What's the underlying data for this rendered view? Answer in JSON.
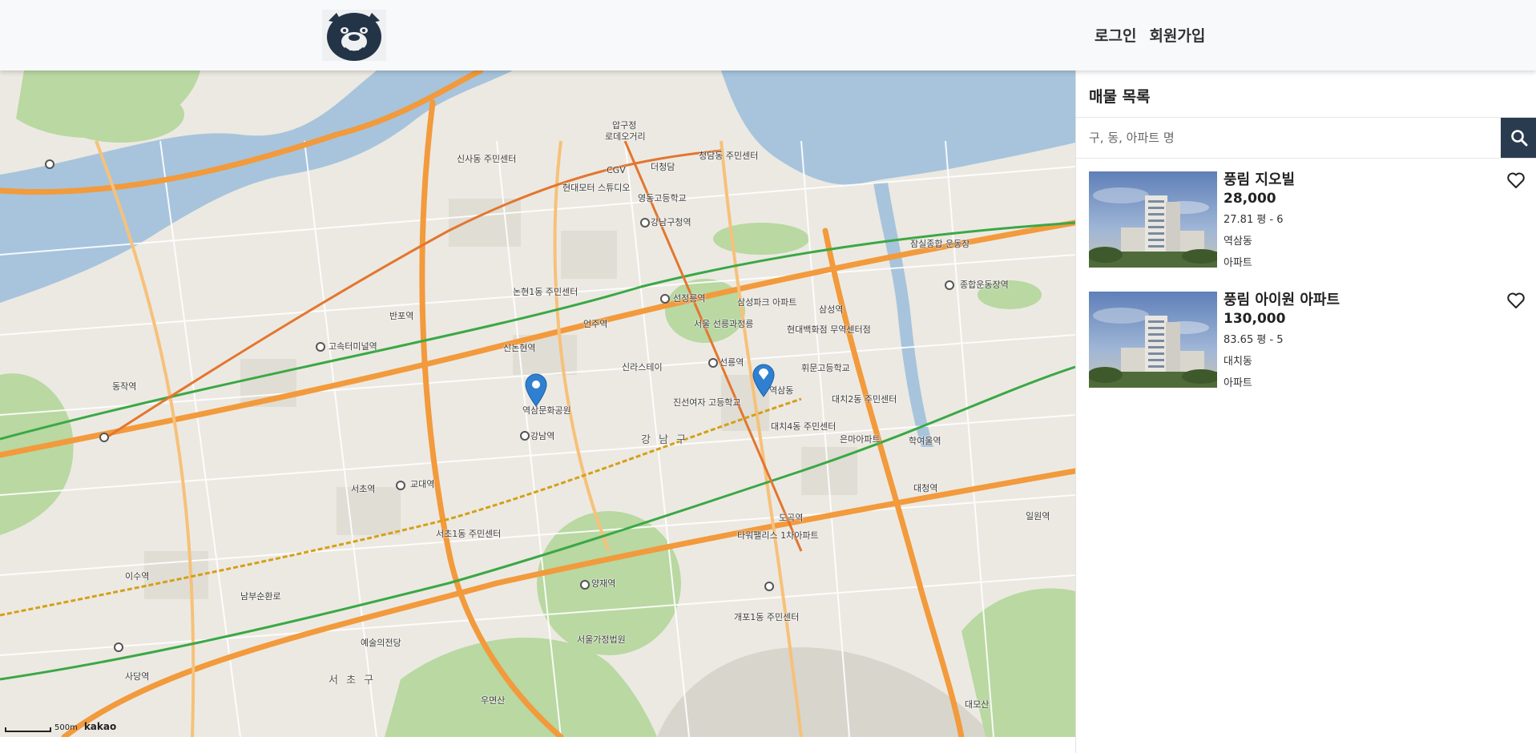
{
  "header": {
    "login_label": "로그인",
    "signup_label": "회원가입"
  },
  "sidebar": {
    "title": "매물 목록",
    "search_placeholder": "구, 동, 아파트 명",
    "listings": [
      {
        "name": "풍림 지오빌",
        "price": "28,000",
        "detail": "27.81 평 - 6",
        "dong": "역삼동",
        "type": "아파트"
      },
      {
        "name": "풍림 아이원 아파트",
        "price": "130,000",
        "detail": "83.65 평 - 5",
        "dong": "대치동",
        "type": "아파트"
      }
    ]
  },
  "map": {
    "scale_label": "500m",
    "provider_label": "kakao",
    "district_labels": [
      "강 남 구",
      "서 초 구"
    ],
    "place_labels": [
      "압구정",
      "로데오거리",
      "신사동 주민센터",
      "현대모터 스튜디오",
      "CGV",
      "더청담",
      "청담동 주민센터",
      "영동고등학교",
      "강남구청역",
      "논현1동 주민센터",
      "신논현역",
      "언주역",
      "선정릉역",
      "삼성파크 아파트",
      "서울 선릉과정릉",
      "현대백화점 무역센터점",
      "선릉역",
      "삼성역",
      "종합운동장역",
      "역삼문화공원",
      "강남역",
      "역삼동",
      "신라스테이",
      "진선여자 고등학교",
      "대치4동 주민센터",
      "교대역",
      "서초1동 주민센터",
      "양재역",
      "도곡역",
      "타워팰리스 1차아파트",
      "개포1동 주민센터",
      "대모산",
      "잠실종합 운동장",
      "동작역",
      "고속터미널역",
      "반포역",
      "서초역",
      "이수역",
      "사당역",
      "남부순환로",
      "휘문고등학교",
      "대치2동 주민센터",
      "은마아파트",
      "학여울역",
      "대청역",
      "일원역",
      "서울가정법원",
      "예술의전당",
      "우면산"
    ],
    "markers": [
      "marker-1",
      "marker-2"
    ],
    "colors": {
      "water": "#a7c4dc",
      "park": "#b9d8a2",
      "road_major": "#f29a3c",
      "subway_green": "#3aa845",
      "marker": "#2f80d1"
    }
  }
}
